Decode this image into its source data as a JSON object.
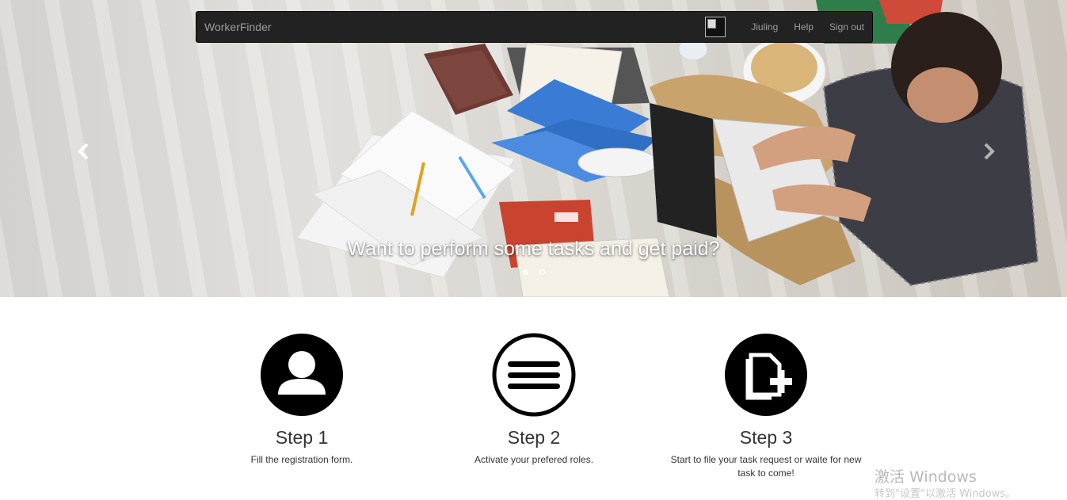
{
  "navbar": {
    "brand": "WorkerFinder",
    "links": [
      "Jiuling",
      "Help",
      "Sign out"
    ]
  },
  "carousel": {
    "caption": "Want to perform some tasks and get paid?",
    "slides_count": 2,
    "active_slide": 1
  },
  "steps": [
    {
      "title": "Step 1",
      "desc": "Fill the registration form.",
      "icon": "user-icon"
    },
    {
      "title": "Step 2",
      "desc": "Activate your prefered roles.",
      "icon": "menu-icon"
    },
    {
      "title": "Step 3",
      "desc": "Start to file your task request or waite for new task to come!",
      "icon": "add-document-icon"
    }
  ],
  "watermark": {
    "line1": "激活 Windows",
    "line2": "转到\"设置\"以激活 Windows。"
  },
  "colors": {
    "navbar_bg": "#222222",
    "nav_text": "#9d9d9d",
    "step_icon": "#000000"
  }
}
